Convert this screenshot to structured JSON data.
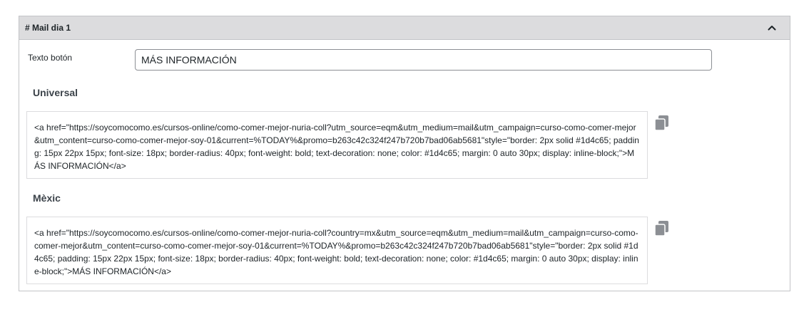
{
  "panel": {
    "title": "# Mail dia 1",
    "collapse_icon": "chevron-up-icon"
  },
  "button_text": {
    "label": "Texto botón",
    "value": "MÁS INFORMACIÓN"
  },
  "sections": [
    {
      "title": "Universal",
      "code": "<a href=\"https://soycomocomo.es/cursos-online/como-comer-mejor-nuria-coll?utm_source=eqm&utm_medium=mail&utm_campaign=curso-como-comer-mejor&utm_content=curso-como-comer-mejor-soy-01&current=%TODAY%&promo=b263c42c324f247b720b7bad06ab5681\"style=\"border: 2px solid #1d4c65; padding: 15px 22px 15px; font-size: 18px; border-radius: 40px; font-weight: bold; text-decoration: none; color: #1d4c65; margin: 0 auto 30px; display: inline-block;\">MÁS INFORMACIÓN</a>",
      "copy_icon": "copy-icon"
    },
    {
      "title": "Mèxic",
      "code": "<a href=\"https://soycomocomo.es/cursos-online/como-comer-mejor-nuria-coll?country=mx&utm_source=eqm&utm_medium=mail&utm_campaign=curso-como-comer-mejor&utm_content=curso-como-comer-mejor-soy-01&current=%TODAY%&promo=b263c42c324f247b720b7bad06ab5681\"style=\"border: 2px solid #1d4c65; padding: 15px 22px 15px; font-size: 18px; border-radius: 40px; font-weight: bold; text-decoration: none; color: #1d4c65; margin: 0 auto 30px; display: inline-block;\">MÁS INFORMACIÓN</a>",
      "copy_icon": "copy-icon"
    }
  ],
  "colors": {
    "header_bg": "#dcdcde",
    "border": "#c3c4c7",
    "icon": "#8c8f94"
  }
}
